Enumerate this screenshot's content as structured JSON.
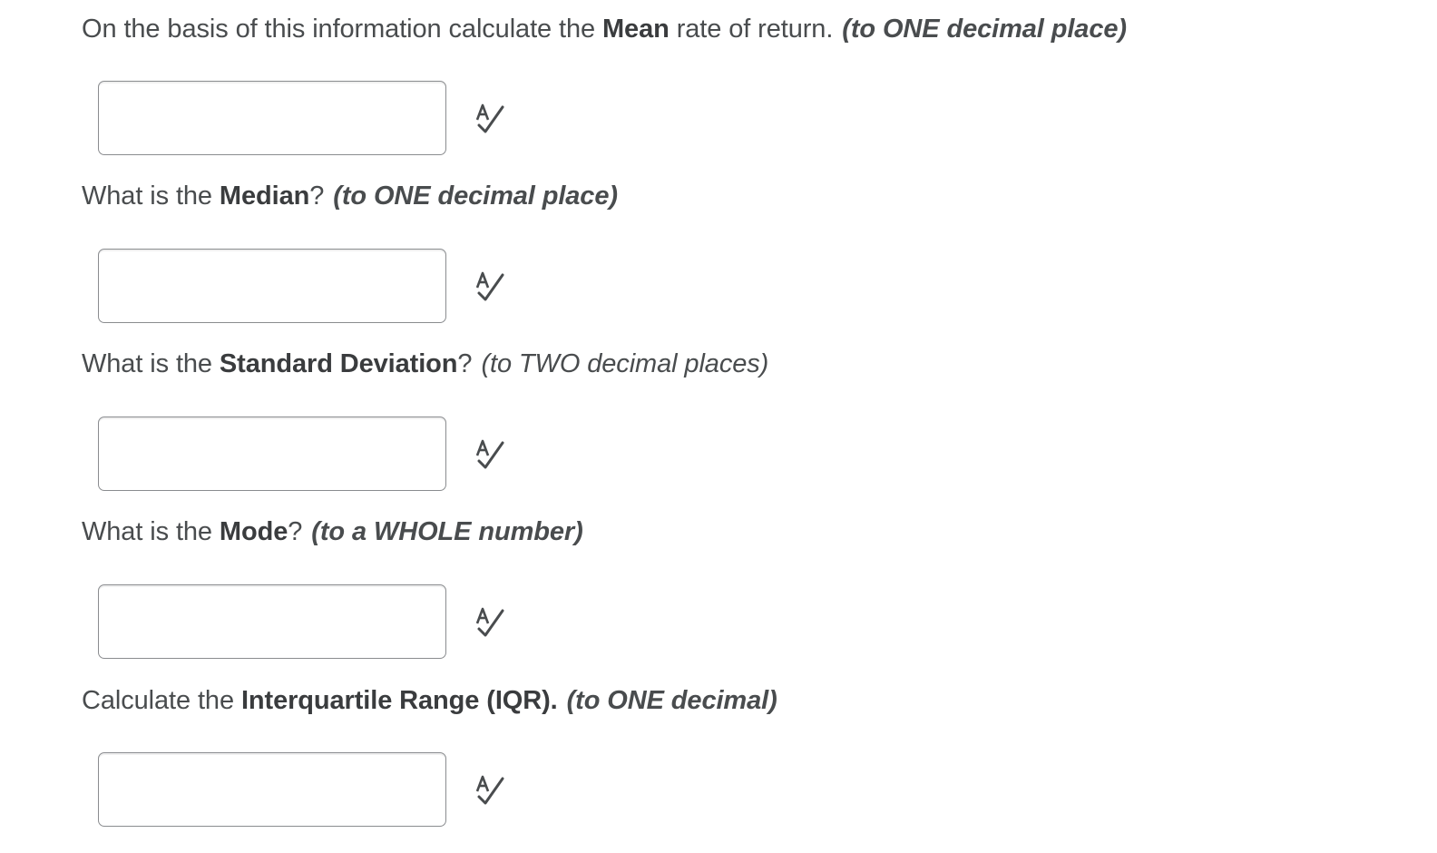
{
  "questions": [
    {
      "prefix": "On the basis of this information calculate the ",
      "bold": "Mean",
      "suffix": " rate of return.",
      "hint": "(to ONE decimal place)",
      "hint_bold": true,
      "answer_value": ""
    },
    {
      "prefix": "What is the ",
      "bold": "Median",
      "suffix": "?",
      "hint": "(to ONE decimal place)",
      "hint_bold": true,
      "answer_value": ""
    },
    {
      "prefix": "What is the ",
      "bold": "Standard Deviation",
      "suffix": "?",
      "hint": "(to TWO decimal places)",
      "hint_bold": false,
      "answer_value": ""
    },
    {
      "prefix": "What is the ",
      "bold": "Mode",
      "suffix": "?",
      "hint": "(to a WHOLE number)",
      "hint_bold": true,
      "answer_value": ""
    },
    {
      "prefix": "Calculate the ",
      "bold": "Interquartile Range (IQR).",
      "suffix": "",
      "hint": "(to ONE decimal)",
      "hint_bold": true,
      "answer_value": ""
    }
  ],
  "icons": {
    "spell_check": "spell-check-icon"
  },
  "colors": {
    "text": "#494c4e",
    "input_border": "#8a8c8f"
  }
}
